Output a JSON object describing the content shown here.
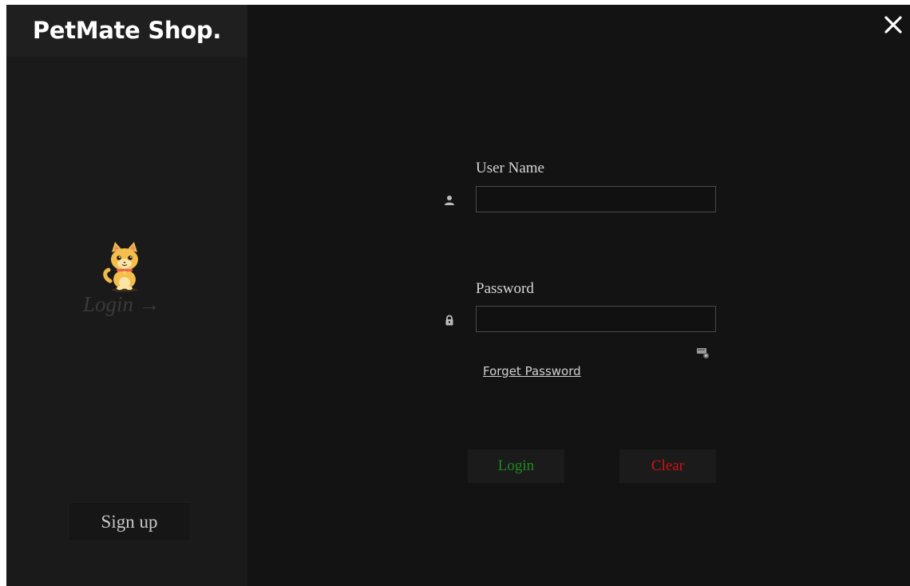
{
  "window": {
    "brand": "PetMate Shop."
  },
  "sidebar": {
    "login_label": "Login →",
    "signup_label": "Sign up"
  },
  "form": {
    "username": {
      "label": "User Name",
      "value": "",
      "placeholder": ""
    },
    "password": {
      "label": "Password",
      "value": "",
      "placeholder": ""
    },
    "forget_label": "Forget Password",
    "login_button": "Login",
    "clear_button": "Clear"
  },
  "icons": {
    "close": "close-icon",
    "user": "user-icon",
    "lock": "lock-icon",
    "key": "key-icon",
    "pet": "cat-mascot-icon"
  },
  "colors": {
    "background": "#131313",
    "sidebar": "#1a1a1a",
    "brand_bar": "#1f1f1f",
    "login_button_text": "#1f8a1f",
    "clear_button_text": "#d41212"
  }
}
